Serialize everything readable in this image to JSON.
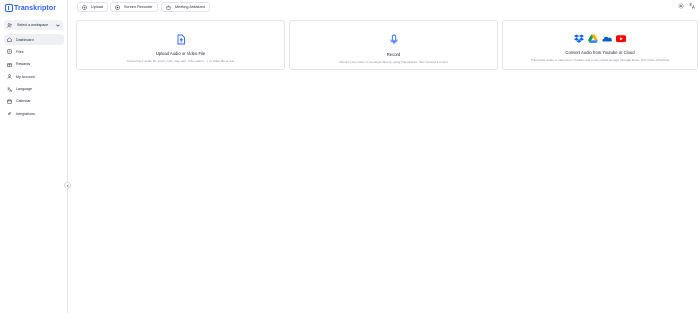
{
  "app": {
    "logo_text": "Transkriptor"
  },
  "sidebar": {
    "workspace_label": "Select a workspace",
    "items": [
      {
        "label": "Dashboard",
        "icon": "home-icon",
        "active": true
      },
      {
        "label": "Files",
        "icon": "file-icon",
        "active": false
      },
      {
        "label": "Rewards",
        "icon": "gift-icon",
        "active": false
      },
      {
        "label": "My Account",
        "icon": "user-icon",
        "active": false
      },
      {
        "label": "Language",
        "icon": "language-icon",
        "active": false
      },
      {
        "label": "Calendar",
        "icon": "calendar-icon",
        "active": false
      },
      {
        "label": "Integrations",
        "icon": "plug-icon",
        "active": false
      }
    ]
  },
  "topbar": {
    "upload_label": "Upload",
    "screen_recorder_label": "Screen Recorder",
    "meeting_assistant_label": "Meeting Assistant"
  },
  "cards": {
    "upload": {
      "title": "Upload Audio or Video File",
      "description": "Convert any audio file (mp3, mp4, wav, aac, m4a, webm,...) or video file to text"
    },
    "record": {
      "title": "Record",
      "description": "Record your voice or meetings directly using Transkriptor, then convert it to text"
    },
    "cloud": {
      "title": "Convert Audio from Youtube or Cloud",
      "description": "Transcribe audio or video from Youtube link or any cloud storage (Google Drive, One Drive, Dropbox)"
    }
  },
  "colors": {
    "brand": "#2f63f5",
    "dropbox": "#0061fe",
    "youtube": "#ff0000",
    "onedrive": "#0a5ec4"
  }
}
